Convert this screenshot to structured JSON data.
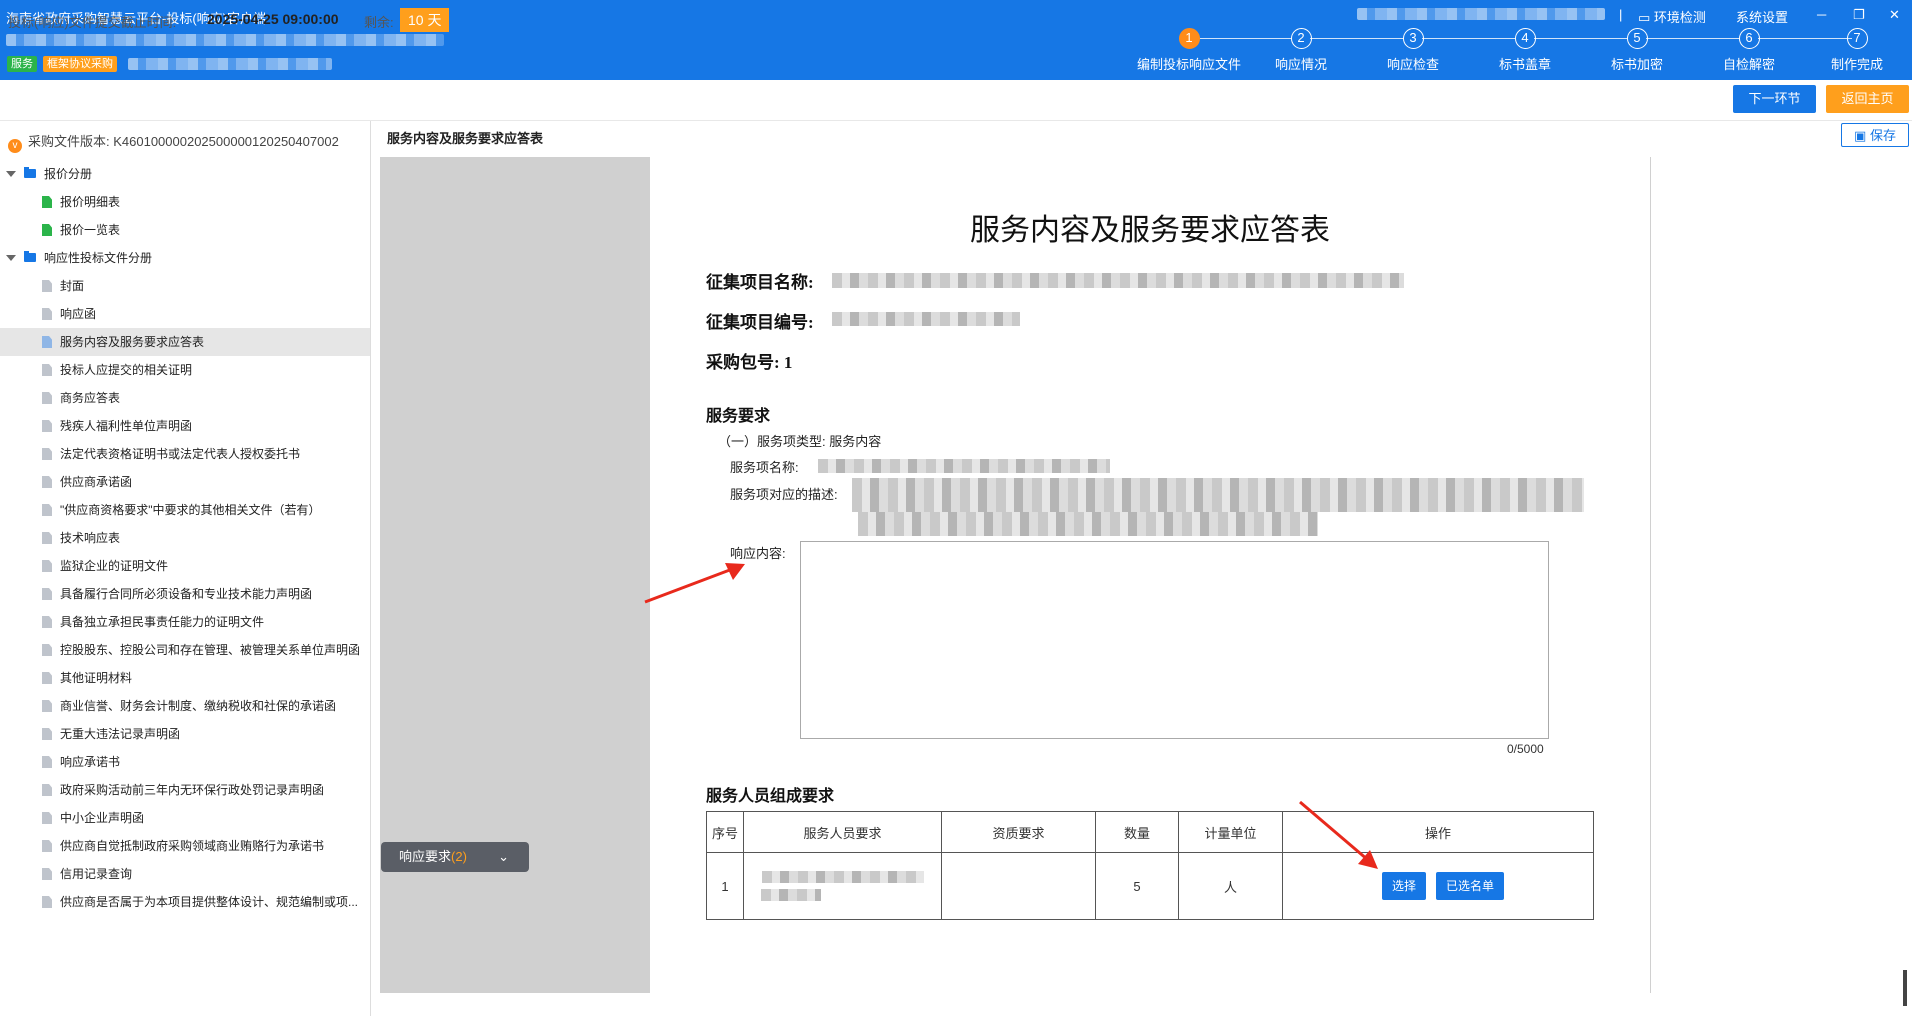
{
  "window": {
    "title": "海南省政府采购智慧云平台-投标(响应)客户端",
    "env_check": "环境检测",
    "settings": "系统设置",
    "minimize": "─",
    "restore": "❐",
    "close": "✕"
  },
  "tags": {
    "service": "服务",
    "framework": "框架协议采购"
  },
  "steps": [
    {
      "num": "1",
      "label": "编制投标响应文件"
    },
    {
      "num": "2",
      "label": "响应情况"
    },
    {
      "num": "3",
      "label": "响应检查"
    },
    {
      "num": "4",
      "label": "标书盖章"
    },
    {
      "num": "5",
      "label": "标书加密"
    },
    {
      "num": "6",
      "label": "自检解密"
    },
    {
      "num": "7",
      "label": "制作完成"
    }
  ],
  "deadline": {
    "label": "投标(响应)文件提交截止时间:",
    "date": "2025-04-25 09:00:00",
    "remain_label": "剩余:",
    "days": "10 天"
  },
  "actions": {
    "next": "下一环节",
    "home": "返回主页",
    "save": "保存"
  },
  "sidebar": {
    "version_label": "采购文件版本: K460100000202500000120250407002",
    "groups": [
      {
        "label": "报价分册",
        "items": [
          "报价明细表",
          "报价一览表"
        ]
      },
      {
        "label": "响应性投标文件分册",
        "items": [
          "封面",
          "响应函",
          "服务内容及服务要求应答表",
          "投标人应提交的相关证明",
          "商务应答表",
          "残疾人福利性单位声明函",
          "法定代表资格证明书或法定代表人授权委托书",
          "供应商承诺函",
          "\"供应商资格要求\"中要求的其他相关文件（若有）",
          "技术响应表",
          "监狱企业的证明文件",
          "具备履行合同所必须设备和专业技术能力声明函",
          "具备独立承担民事责任能力的证明文件",
          "控股股东、控股公司和存在管理、被管理关系单位声明函",
          "其他证明材料",
          "商业信誉、财务会计制度、缴纳税收和社保的承诺函",
          "无重大违法记录声明函",
          "响应承诺书",
          "政府采购活动前三年内无环保行政处罚记录声明函",
          "中小企业声明函",
          "供应商自觉抵制政府采购领域商业贿赂行为承诺书",
          "信用记录查询",
          "供应商是否属于为本项目提供整体设计、规范编制或项..."
        ]
      }
    ]
  },
  "content": {
    "header_title": "服务内容及服务要求应答表",
    "doc_title": "服务内容及服务要求应答表",
    "project_name_label": "征集项目名称:",
    "project_no_label": "征集项目编号:",
    "package_label": "采购包号:",
    "package_value": "1",
    "service_req_heading": "服务要求",
    "service_type": "（一）服务项类型: 服务内容",
    "service_name_label": "服务项名称:",
    "service_desc_label": "服务项对应的描述:",
    "response_label": "响应内容:",
    "counter": "0/5000",
    "staff_heading": "服务人员组成要求",
    "table_headers": [
      "序号",
      "服务人员要求",
      "资质要求",
      "数量",
      "计量单位",
      "操作"
    ],
    "table_row": {
      "seq": "1",
      "qual": "",
      "qty": "5",
      "unit": "人"
    },
    "select_btn": "选择",
    "selected_list_btn": "已选名单",
    "resp_req_label": "响应要求",
    "resp_req_count": "(2)"
  }
}
